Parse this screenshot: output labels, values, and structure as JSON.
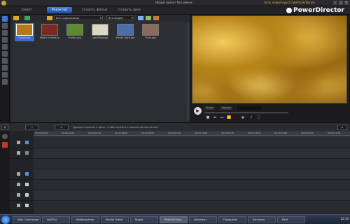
{
  "window": {
    "title": "Новый проект без имени",
    "update_link": "Есть новый курс/ CyberLink/Dunya"
  },
  "modes": [
    {
      "label": "Захват",
      "active": false
    },
    {
      "label": "Редактор",
      "active": true
    },
    {
      "label": "Создать фильм",
      "active": false
    },
    {
      "label": "Создать диск",
      "active": false
    }
  ],
  "brand": "PowerDirector",
  "library": {
    "filter_dropdown": "Все содержимое",
    "media_dropdown": "Все медиа",
    "items": [
      {
        "name": "Bright.jpg",
        "selected": true,
        "color": "#b5781a"
      },
      {
        "name": "Maple Leaves.jpg",
        "selected": false,
        "color": "#7a2a22"
      },
      {
        "name": "Kahan.jpg",
        "selected": false,
        "color": "#5c8a2e"
      },
      {
        "name": "sandflow.jpg",
        "selected": false,
        "color": "#dcd8c8"
      },
      {
        "name": "Street Light.jpg",
        "selected": false,
        "color": "#4a6fa8"
      },
      {
        "name": "Train.jpg",
        "selected": false,
        "color": "#8a6a5a"
      }
    ]
  },
  "preview": {
    "tabs": [
      "Клип",
      "Фильм"
    ]
  },
  "timeline": {
    "hint": "Дважды щелкните здесь, чтобы перейти к временной шкале или",
    "btn_zoom": "⊕",
    "ticks": [
      "00;00;00;00",
      "00;00;02;00",
      "00;00;04;00",
      "00;00;06;00",
      "00;00;08;00",
      "00;00;10;00",
      "00;00;12;00",
      "00;00;14;00",
      "00;00;16;00",
      "00;00;18;00",
      "00;00;20;00",
      "00;00;22;00"
    ],
    "tracks": [
      "video-1",
      "effect",
      "video-2",
      "title",
      "voice",
      "music"
    ]
  },
  "taskbar": {
    "tasks": [
      "Total Commander",
      "ФАЙЛЫ",
      "Изображения",
      "Mozilla Firefox",
      "Видео",
      "PowerDirector",
      "Документ",
      "Проводник",
      "Загрузки",
      "Paint"
    ],
    "clock": "12:30"
  }
}
